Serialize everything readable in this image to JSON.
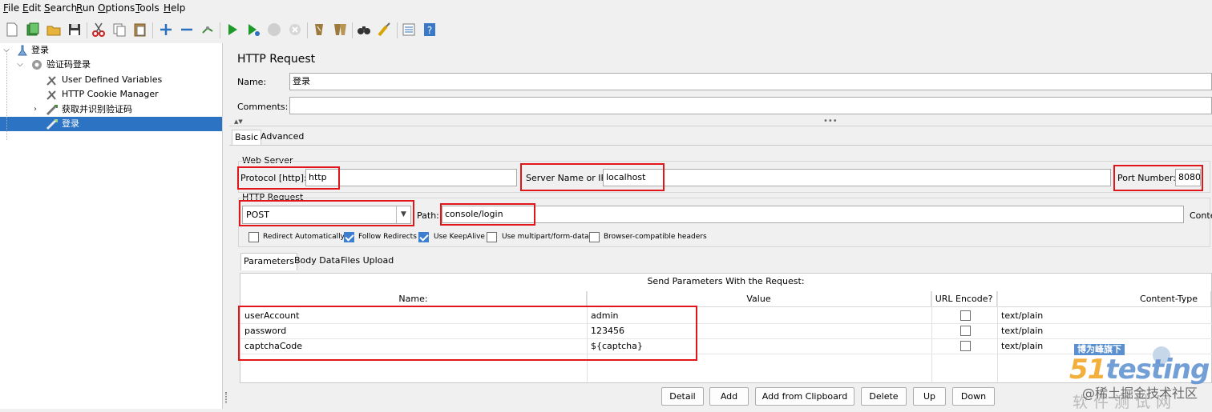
{
  "menu": [
    "File",
    "Edit",
    "Search",
    "Run",
    "Options",
    "Tools",
    "Help"
  ],
  "menu_mnemonic": [
    "F",
    "E",
    "S",
    "R",
    "O",
    "T",
    "H"
  ],
  "tree": {
    "root": "登录",
    "thread_group": "验证码登录",
    "udv": "User Defined Variables",
    "cookie": "HTTP Cookie Manager",
    "captcha_req": "获取并识别验证码",
    "login_req": "登录"
  },
  "panel": {
    "title": "HTTP Request",
    "name_label": "Name:",
    "name_value": "登录",
    "comments_label": "Comments:",
    "comments_value": "",
    "tabs": [
      "Basic",
      "Advanced"
    ],
    "web_server_title": "Web Server",
    "protocol_label": "Protocol [http]:",
    "protocol_value": "http",
    "server_label": "Server Name or IP:",
    "server_value": "localhost",
    "port_label": "Port Number:",
    "port_value": "8080",
    "http_request_title": "HTTP Request",
    "method_value": "POST",
    "path_label": "Path:",
    "path_value": "console/login",
    "content_encoding_label": "Conte",
    "checkboxes": [
      {
        "label": "Redirect Automatically",
        "checked": false
      },
      {
        "label": "Follow Redirects",
        "checked": true
      },
      {
        "label": "Use KeepAlive",
        "checked": true
      },
      {
        "label": "Use multipart/form-data",
        "checked": false
      },
      {
        "label": "Browser-compatible headers",
        "checked": false
      }
    ],
    "subtabs": [
      "Parameters",
      "Body Data",
      "Files Upload"
    ],
    "table_caption": "Send Parameters With the Request:",
    "columns": [
      "Name:",
      "Value",
      "URL Encode?",
      "Content-Type"
    ],
    "rows": [
      {
        "name": "userAccount",
        "value": "admin",
        "url_encode": false,
        "content_type": "text/plain"
      },
      {
        "name": "password",
        "value": "123456",
        "url_encode": false,
        "content_type": "text/plain"
      },
      {
        "name": "captchaCode",
        "value": "${captcha}",
        "url_encode": false,
        "content_type": "text/plain"
      }
    ],
    "buttons": [
      "Detail",
      "Add",
      "Add from Clipboard",
      "Delete",
      "Up",
      "Down"
    ]
  },
  "watermark": {
    "badge": "博为峰旗下",
    "logo_num": "51",
    "logo_text": "testing",
    "cn": "软件测试网",
    "overlay": "@稀土掘金技术社区"
  },
  "colors": {
    "selection": "#2d73c4",
    "highlight_box": "#e0161b",
    "checkbox_on": "#3c7fd1"
  }
}
